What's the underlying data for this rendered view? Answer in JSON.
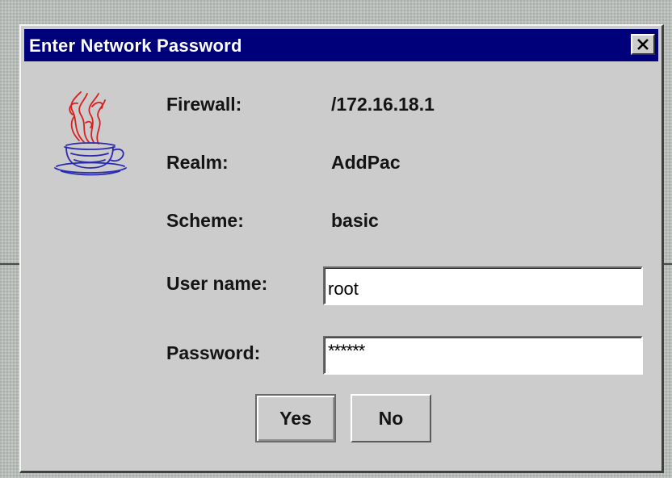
{
  "dialog": {
    "title": "Enter Network Password",
    "close_label": "close"
  },
  "icon": "java-coffee-cup-icon",
  "fields": {
    "firewall_label": "Firewall:",
    "firewall_value": "/172.16.18.1",
    "realm_label": "Realm:",
    "realm_value": "AddPac",
    "scheme_label": "Scheme:",
    "scheme_value": "basic",
    "username_label": "User name:",
    "username_value": "root",
    "password_label": "Password:",
    "password_mask": "******"
  },
  "buttons": {
    "yes_label": "Yes",
    "no_label": "No"
  },
  "colors": {
    "title_bar": "#00007b",
    "dialog_face": "#cccccc"
  }
}
